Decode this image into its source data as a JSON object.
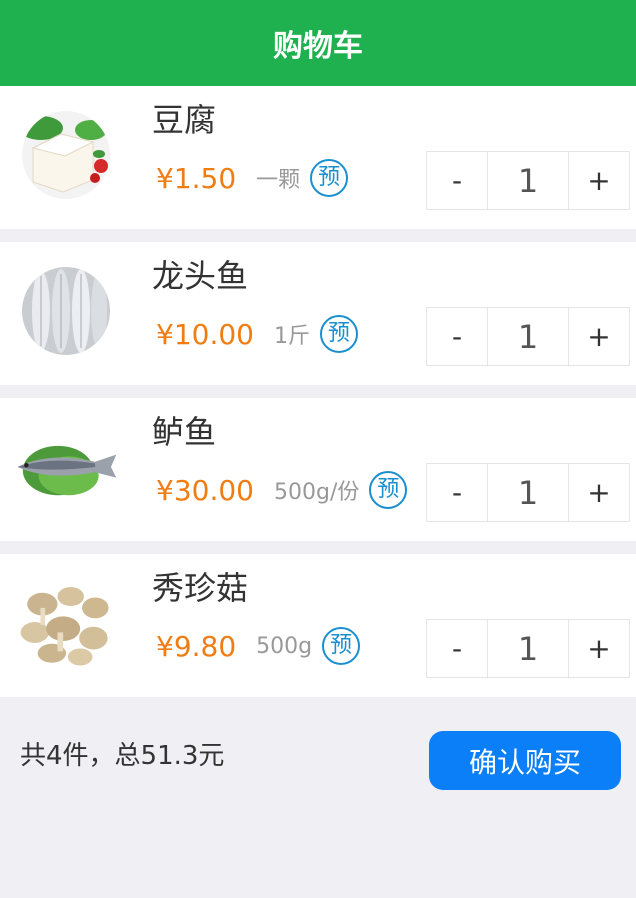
{
  "header": {
    "title": "购物车"
  },
  "items": [
    {
      "name": "豆腐",
      "price": "¥1.50",
      "unit": "一颗",
      "badge": "预",
      "qty": "1",
      "minus": "-",
      "plus": "+",
      "image": "tofu-image"
    },
    {
      "name": "龙头鱼",
      "price": "¥10.00",
      "unit": "1斤",
      "badge": "预",
      "qty": "1",
      "minus": "-",
      "plus": "+",
      "image": "bombay-duck-fish-image"
    },
    {
      "name": "鲈鱼",
      "price": "¥30.00",
      "unit": "500g/份",
      "badge": "预",
      "qty": "1",
      "minus": "-",
      "plus": "+",
      "image": "sea-bass-image"
    },
    {
      "name": "秀珍菇",
      "price": "¥9.80",
      "unit": "500g",
      "badge": "预",
      "qty": "1",
      "minus": "-",
      "plus": "+",
      "image": "oyster-mushroom-image"
    }
  ],
  "footer": {
    "summary": "共4件，总51.3元",
    "confirm_label": "确认购买"
  },
  "colors": {
    "header": "#1fb04f",
    "price": "#f07d14",
    "badge": "#1a8fd0",
    "confirm": "#0a7ff7"
  }
}
